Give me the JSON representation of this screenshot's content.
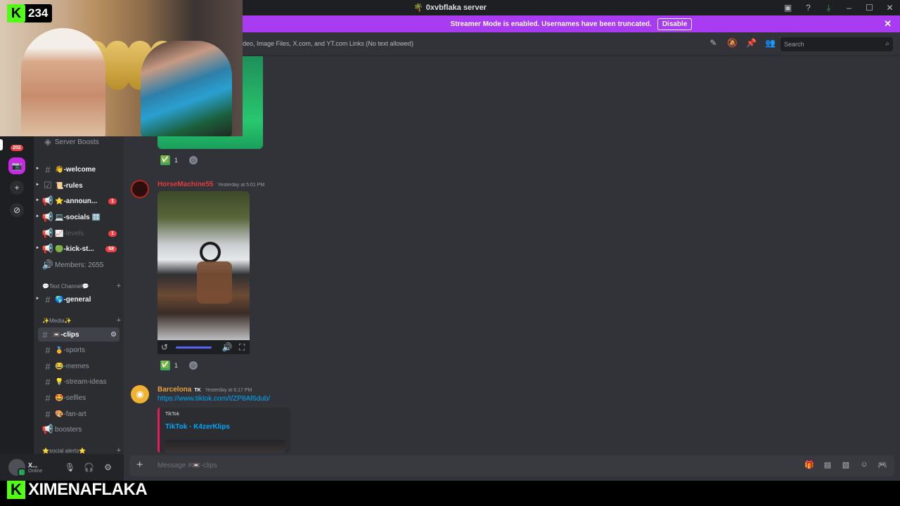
{
  "window": {
    "title": "0xvbflaka server"
  },
  "banner": {
    "text": "Streamer Mode is enabled. Usernames have been truncated.",
    "disable_label": "Disable"
  },
  "overlay": {
    "kick_viewers": "234",
    "streamer_name": "XIMENAFLAKA"
  },
  "rail": {
    "badge": "202"
  },
  "channels": {
    "server_boosts": "Server Boosts",
    "items": [
      {
        "label": "👋-welcome"
      },
      {
        "label": "📜-rules"
      },
      {
        "label": "⭐-announ...",
        "badge": "1"
      },
      {
        "label": "💻-socials 🔠"
      },
      {
        "label": "📈-levels",
        "badge": "1"
      },
      {
        "label": "🟢-kick-st...",
        "badge": "58"
      },
      {
        "label": "Members: 2655"
      }
    ],
    "cat_text": "💬Text Channel💬",
    "general": "🌎-general",
    "cat_media": "✨Media✨",
    "media": [
      {
        "label": "📼-clips"
      },
      {
        "label": "🏅-sports"
      },
      {
        "label": "😂-memes"
      },
      {
        "label": "💡-stream-ideas"
      },
      {
        "label": "🤩-selfies"
      },
      {
        "label": "🎨-fan-art"
      },
      {
        "label": "boosters"
      }
    ],
    "cat_social": "⭐social alerts⭐"
  },
  "user": {
    "name": "X...",
    "status": "Online"
  },
  "topic": {
    "text": "deo, Image Files, X.com, and YT.com Links (No text allowed)",
    "search_placeholder": "Search"
  },
  "messages": [
    {
      "reaction": "✅",
      "count": "1"
    },
    {
      "author": "HorseMachine55",
      "time": "Yesterday at 5:01 PM",
      "author_color": "#e03c3c",
      "reaction": "✅",
      "count": "1"
    },
    {
      "author": "Barcelona",
      "tag": "TK",
      "time": "Yesterday at 6:17 PM",
      "author_color": "#e8a23c",
      "link": "https://www.tiktok.com/t/ZP8Af6dub/",
      "embed_provider": "TikTok",
      "embed_title": "TikTok · K4zerKlips"
    }
  ],
  "composer": {
    "placeholder": "Message #📼-clips"
  },
  "colors": {
    "accent": "#5865f2",
    "streamer_banner": "#a93bf2",
    "kick_green": "#53fc18"
  }
}
